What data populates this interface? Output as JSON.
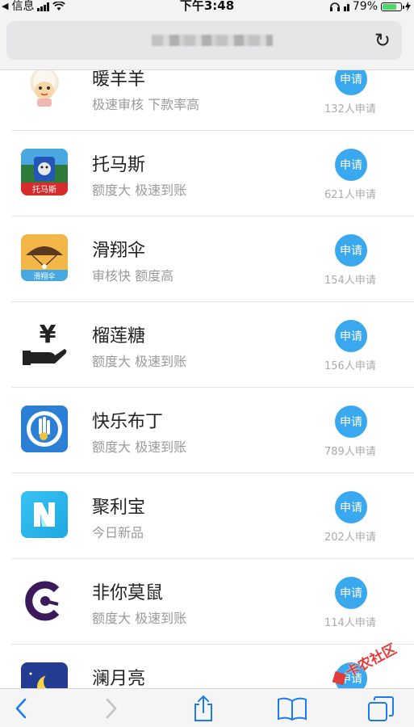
{
  "status_bar": {
    "back_app": "信息",
    "time": "下午3:48",
    "battery": "79%",
    "battery_level": 0.79
  },
  "browser": {
    "reload_icon": "reload-icon"
  },
  "apps": [
    {
      "name": "暖羊羊",
      "desc": "极速审核 下款率高",
      "button": "申请",
      "count": "132人申请",
      "icon": "sheep-icon"
    },
    {
      "name": "托马斯",
      "desc": "额度大 极速到账",
      "button": "申请",
      "count": "621人申请",
      "icon": "train-icon",
      "icon_label": "托马斯"
    },
    {
      "name": "滑翔伞",
      "desc": "审核快 额度高",
      "button": "申请",
      "count": "154人申请",
      "icon": "paraglider-icon",
      "icon_label": "滑翔伞"
    },
    {
      "name": "榴莲糖",
      "desc": "额度大 极速到账",
      "button": "申请",
      "count": "156人申请",
      "icon": "yen-hand-icon"
    },
    {
      "name": "快乐布丁",
      "desc": "额度大 极速到账",
      "button": "申请",
      "count": "789人申请",
      "icon": "hand-coin-icon"
    },
    {
      "name": "聚利宝",
      "desc": "今日新品",
      "button": "申请",
      "count": "202人申请",
      "icon": "n-logo-icon"
    },
    {
      "name": "非你莫鼠",
      "desc": "额度大 极速到账",
      "button": "申请",
      "count": "114人申请",
      "icon": "c-logo-icon"
    },
    {
      "name": "澜月亮",
      "desc": "",
      "button": "申请",
      "count": "",
      "icon": "moon-icon"
    }
  ],
  "toolbar": {
    "back": "back-icon",
    "forward": "forward-icon",
    "share": "share-icon",
    "bookmarks": "bookmarks-icon",
    "tabs": "tabs-icon"
  },
  "watermark": "卡农社区"
}
